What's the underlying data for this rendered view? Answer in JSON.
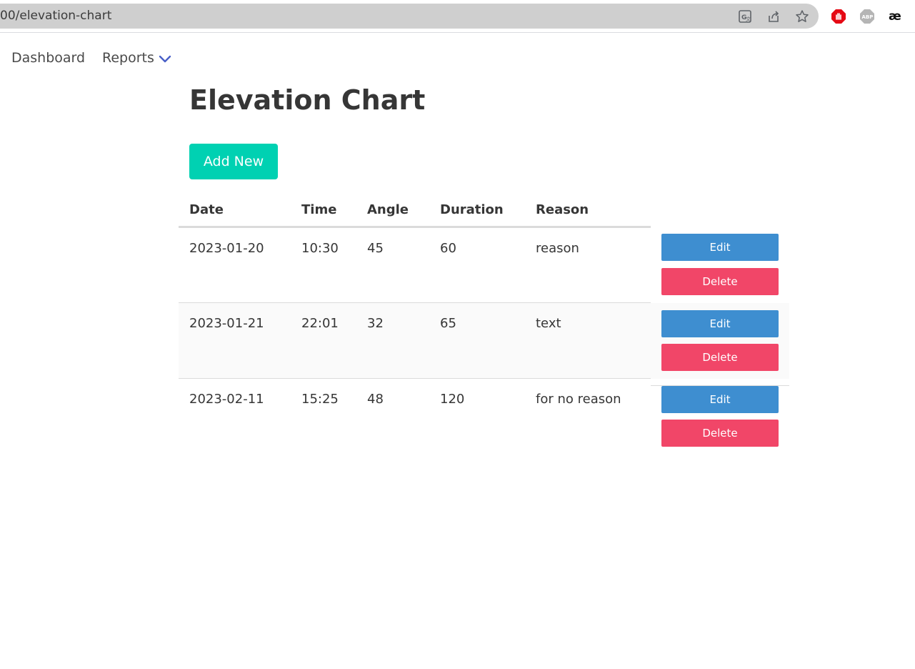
{
  "browser": {
    "url": "00/elevation-chart"
  },
  "nav": {
    "items": [
      {
        "label": "Dashboard"
      },
      {
        "label": "Reports"
      }
    ]
  },
  "page": {
    "title": "Elevation Chart",
    "add_button": "Add New"
  },
  "table": {
    "columns": [
      "Date",
      "Time",
      "Angle",
      "Duration",
      "Reason"
    ],
    "rows": [
      {
        "date": "2023-01-20",
        "time": "10:30",
        "angle": "45",
        "duration": "60",
        "reason": "reason"
      },
      {
        "date": "2023-01-21",
        "time": "22:01",
        "angle": "32",
        "duration": "65",
        "reason": "text"
      },
      {
        "date": "2023-02-11",
        "time": "15:25",
        "angle": "48",
        "duration": "120",
        "reason": "for no reason"
      }
    ],
    "edit_label": "Edit",
    "delete_label": "Delete"
  },
  "colors": {
    "primary": "#00d1b2",
    "edit": "#3e8ed0",
    "delete": "#f14668",
    "stripe": "#fafafa"
  }
}
